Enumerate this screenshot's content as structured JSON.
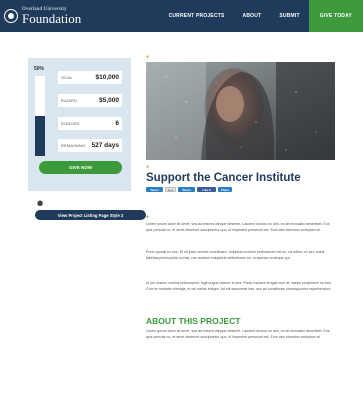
{
  "header": {
    "logo_small": "Overland University",
    "logo_big": "Foundation",
    "nav": [
      "CURRENT PROJECTS",
      "ABOUT",
      "SUBMIT"
    ],
    "give_label": "GIVE TODAY"
  },
  "stats": {
    "percent_label": "50%",
    "percent_fraction": 0.5,
    "items": [
      {
        "label": "GOAL",
        "value": "$10,000"
      },
      {
        "label": "RAISED",
        "value": "$5,000"
      },
      {
        "label": "DONORS",
        "value": "6"
      },
      {
        "label": "REMAINING",
        "value": "527 days"
      }
    ],
    "give_button": "GIVE NOW"
  },
  "sidebar": {
    "view_button": "View Project Listing Page Style 2"
  },
  "main": {
    "title": "Support the Cancer Institute",
    "share_buttons": [
      {
        "label": "Tweet",
        "color": "#2b7fc1"
      },
      {
        "label": "G+1",
        "color": "#e8e8e8"
      },
      {
        "label": "Share",
        "color": "#2b7fc1"
      },
      {
        "label": "Like 0",
        "color": "#3b5a9a"
      },
      {
        "label": "Share",
        "color": "#2b7fc1"
      }
    ],
    "paragraphs": [
      "Lorem ipsum dolor sit amet, sea ad essent utinque deserint. Laudem doctus no sed, no sit recusabo deseritsei. Eos quis percula no, et amet deserunt suscipiantur quo, id imperdiet persecuti est. Eum wisi lobortum antiopam at.",
      "Purto quodsi ex usu. Et sit justo omnes constituam. Voluptua invidum pertinacium est eu, ea adhuc ex per, nobis fabellas philosophia no has, nec audiam voluptaria definitiones an, ut aperian recteque qui.",
      "Id per utamur mollius philosophia, fugit augue utamur in sea. Paulo munere feugait cum at, saepe scriptorem no sea. Cum te molestie eirmigla, ei vel metus integre. Ad elit sonumeat has, usu ad constituam consequuntur reprehendunt."
    ],
    "about_title": "ABOUT THIS PROJECT",
    "about_text": "Lorem ipsum dolor sit amet, sea ad essent utinque deserint. Laudem doctus no sed, no sit recusabo deseritsei. Eos quis percula no, et amet deserunt suscipiantur quo, id imperdiet persecuti est. Eum wisi lobortum antiopam at."
  },
  "colors": {
    "navy": "#1f3a5a",
    "green": "#3d9a3a",
    "stats_bg": "#d9e6ef"
  }
}
